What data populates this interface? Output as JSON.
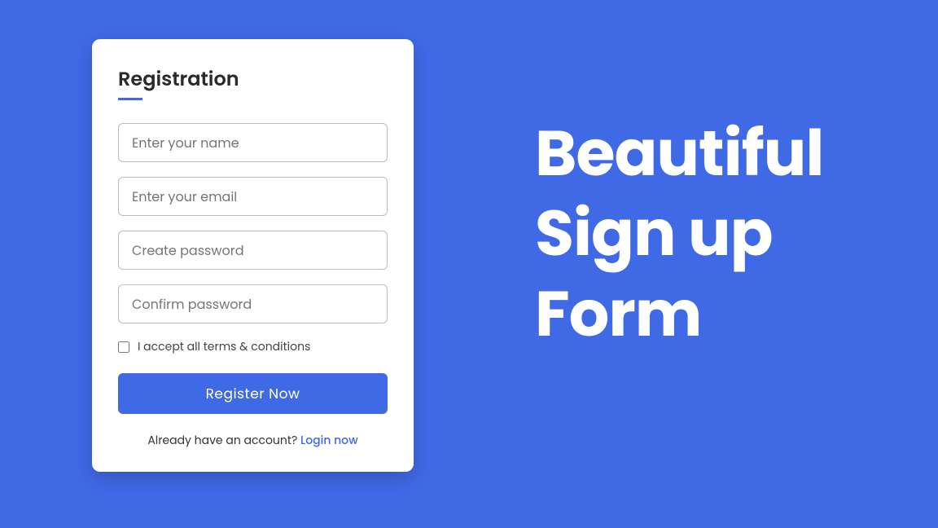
{
  "form": {
    "title": "Registration",
    "fields": {
      "name": {
        "placeholder": "Enter your name",
        "value": ""
      },
      "email": {
        "placeholder": "Enter your email",
        "value": ""
      },
      "password": {
        "placeholder": "Create password",
        "value": ""
      },
      "confirm": {
        "placeholder": "Confirm password",
        "value": ""
      }
    },
    "terms_label": "I accept all terms & conditions",
    "submit_label": "Register Now",
    "login_prompt": "Already have an account? ",
    "login_link": "Login now"
  },
  "hero": {
    "line1": "Beautiful",
    "line2": "Sign up",
    "line3": "Form"
  },
  "colors": {
    "accent": "#4069e5",
    "background": "#4069e5"
  }
}
